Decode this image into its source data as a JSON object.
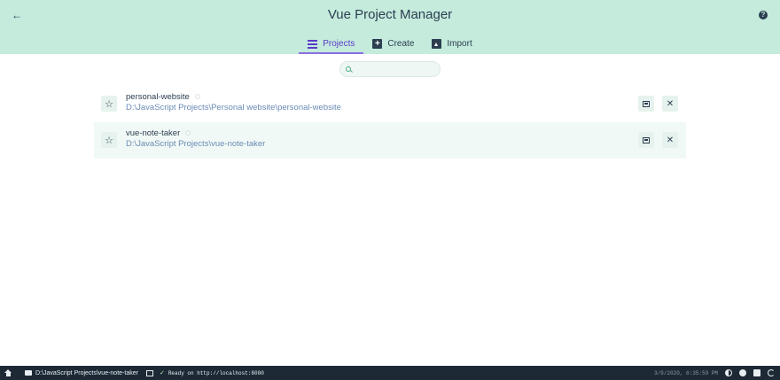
{
  "header": {
    "title": "Vue Project Manager",
    "back_icon": "arrow-left-icon",
    "help_icon": "help-icon",
    "tabs": [
      {
        "label": "Projects",
        "icon": "list-icon",
        "active": true
      },
      {
        "label": "Create",
        "icon": "plus-box-icon",
        "active": false
      },
      {
        "label": "Import",
        "icon": "unarchive-icon",
        "active": false
      }
    ]
  },
  "search": {
    "placeholder": "",
    "value": ""
  },
  "projects": [
    {
      "name": "personal-website",
      "path": "D:\\JavaScript Projects\\Personal website\\personal-website"
    },
    {
      "name": "vue-note-taker",
      "path": "D:\\JavaScript Projects\\vue-note-taker"
    }
  ],
  "statusbar": {
    "cwd": "D:\\JavaScript Projects\\vue-note-taker",
    "log": "Ready on http://localhost:8000",
    "time": "3/9/2020, 6:35:59 PM"
  },
  "colors": {
    "header_bg": "#c4ebdc",
    "accent": "#5a3bc9",
    "statusbar_bg": "#1d2935"
  }
}
